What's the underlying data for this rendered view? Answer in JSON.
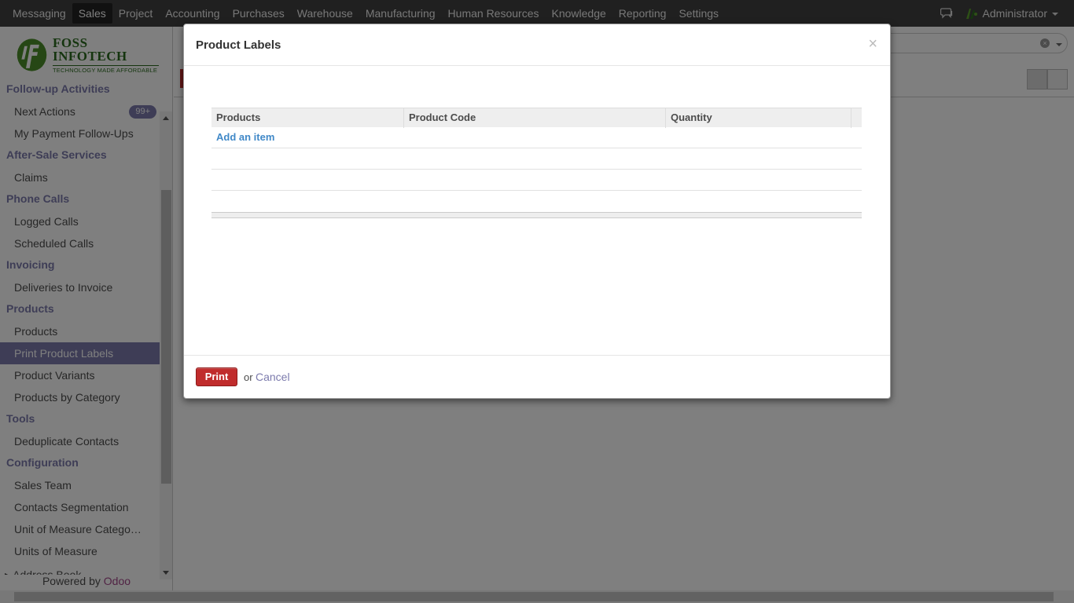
{
  "topnav": {
    "items": [
      "Messaging",
      "Sales",
      "Project",
      "Accounting",
      "Purchases",
      "Warehouse",
      "Manufacturing",
      "Human Resources",
      "Knowledge",
      "Reporting",
      "Settings"
    ],
    "active": "Sales",
    "user": "Administrator"
  },
  "logo": {
    "brand": "FOSS INFOTECH",
    "tagline": "TECHNOLOGY MADE AFFORDABLE"
  },
  "sidebar": {
    "groups": [
      {
        "title": "Follow-up Activities",
        "items": [
          {
            "label": "Next Actions",
            "badge": "99+"
          },
          {
            "label": "My Payment Follow-Ups"
          }
        ]
      },
      {
        "title": "After-Sale Services",
        "items": [
          {
            "label": "Claims"
          }
        ]
      },
      {
        "title": "Phone Calls",
        "items": [
          {
            "label": "Logged Calls"
          },
          {
            "label": "Scheduled Calls"
          }
        ]
      },
      {
        "title": "Invoicing",
        "items": [
          {
            "label": "Deliveries to Invoice"
          }
        ]
      },
      {
        "title": "Products",
        "items": [
          {
            "label": "Products"
          },
          {
            "label": "Print Product Labels",
            "active": true
          },
          {
            "label": "Product Variants"
          },
          {
            "label": "Products by Category"
          }
        ]
      },
      {
        "title": "Tools",
        "items": [
          {
            "label": "Deduplicate Contacts"
          }
        ]
      },
      {
        "title": "Configuration",
        "items": [
          {
            "label": "Sales Team"
          },
          {
            "label": "Contacts Segmentation"
          },
          {
            "label": "Unit of Measure Catego…"
          },
          {
            "label": "Units of Measure"
          }
        ]
      }
    ],
    "address_book": "Address Book",
    "powered_by": "Powered by",
    "powered_brand": "Odoo"
  },
  "modal": {
    "title": "Product Labels",
    "close": "×",
    "columns": [
      "Products",
      "Product Code",
      "Quantity"
    ],
    "add_item": "Add an item",
    "print_label": "Print",
    "or_text": "or",
    "cancel_label": "Cancel"
  }
}
